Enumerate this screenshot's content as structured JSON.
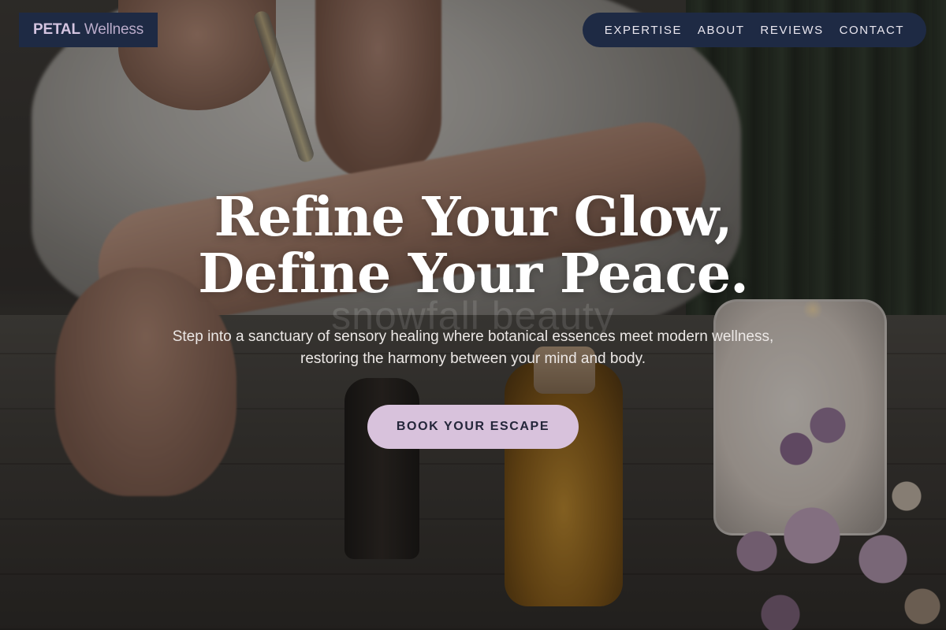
{
  "logo": {
    "brand": "PETAL",
    "sub": "Wellness"
  },
  "nav": {
    "items": [
      {
        "label": "EXPERTISE"
      },
      {
        "label": "ABOUT"
      },
      {
        "label": "REVIEWS"
      },
      {
        "label": "CONTACT"
      }
    ]
  },
  "hero": {
    "headline_line1": "Refine Your Glow,",
    "headline_line2": "Define Your Peace.",
    "watermark": "snowfall beauty",
    "subtext_line1": "Step into a sanctuary of sensory healing where botanical essences meet modern wellness,",
    "subtext_line2": "restoring the harmony between your mind and body.",
    "cta_label": "BOOK YOUR ESCAPE"
  },
  "colors": {
    "navy": "#1e2a44",
    "cta_bg": "#d8c2dc",
    "cta_text": "#24263a",
    "logo_text": "#d4c4e0"
  },
  "icons": []
}
